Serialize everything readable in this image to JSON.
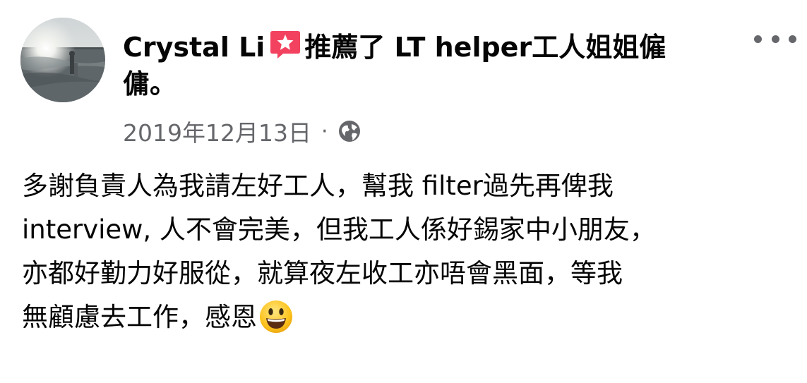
{
  "post": {
    "author_name": "Crystal Li",
    "recommend_icon": "recommend-star-icon",
    "recommend_text_line1": "推薦了 LT helper工人姐姐僱",
    "recommend_text_line2": "傭。",
    "date": "2019年12月13日",
    "separator": "·",
    "privacy_icon": "globe-icon",
    "more_icon": "more-options-icon",
    "body_lines": [
      "多謝負責人為我請左好工人，幫我 filter過先再俾我",
      "interview, 人不會完美，但我工人係好錫家中小朋友，",
      "亦都好勤力好服從，就算夜左收工亦唔會黑面，等我",
      "無顧慮去工作，感恩"
    ],
    "emoji": "smiling-face-emoji"
  },
  "colors": {
    "text_primary": "#050505",
    "text_secondary": "#65676b",
    "recommend_red": "#f3425f"
  }
}
